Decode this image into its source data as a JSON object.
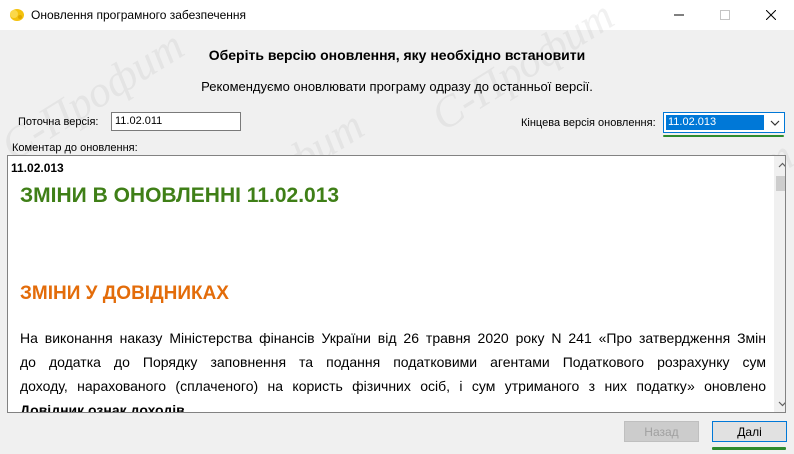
{
  "window": {
    "title": "Оновлення програмного забезпечення",
    "icon": "app-sun-icon"
  },
  "heading": "Оберіть версію оновлення, яку необхідно встановити",
  "subheading": "Рекомендуємо оновлювати програму одразу до останньої версії.",
  "current_version": {
    "label": "Поточна версія:",
    "value": "11.02.011"
  },
  "final_version": {
    "label": "Кінцева версія оновлення:",
    "selected": "11.02.013"
  },
  "comment": {
    "label": "Коментар до оновлення:",
    "version_tag": "11.02.013",
    "heading_main": "ЗМІНИ В ОНОВЛЕННІ 11.02.013",
    "heading_section": "ЗМІНИ У ДОВІДНИКАХ",
    "paragraph_lines": [
      "На виконання наказу Міністерства фінансів України від 26 травня 2020 року N 241 «Про затвердження Змін",
      "до додатка до Порядку заповнення та подання податковими агентами Податкового розрахунку сум",
      "доходу, нарахованого (сплаченого) на користь фізичних осіб, і сум утриманого з них податку» оновлено"
    ],
    "paragraph_bold": "Довідник ознак доходів",
    "paragraph_end": "."
  },
  "watermark": "С-Профит",
  "buttons": {
    "back": "Назад",
    "next": "Далі"
  },
  "colors": {
    "heading_green": "#3f7f17",
    "heading_orange": "#e36c0a",
    "selection_blue": "#0078d7",
    "annotation_green": "#2e8b2e"
  }
}
